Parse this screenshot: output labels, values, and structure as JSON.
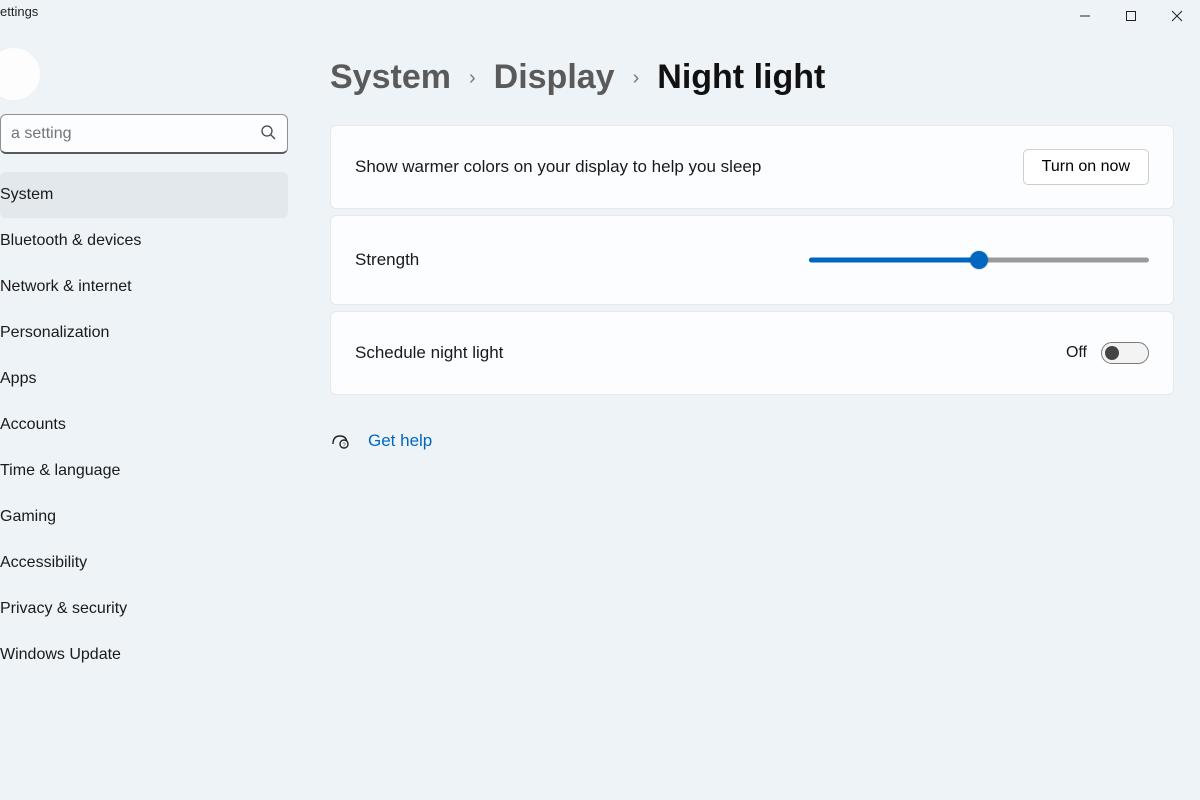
{
  "window": {
    "title": "ettings"
  },
  "search": {
    "placeholder": "a setting"
  },
  "sidebar": {
    "items": [
      {
        "label": "System",
        "active": true
      },
      {
        "label": "Bluetooth & devices"
      },
      {
        "label": "Network & internet"
      },
      {
        "label": "Personalization"
      },
      {
        "label": "Apps"
      },
      {
        "label": "Accounts"
      },
      {
        "label": "Time & language"
      },
      {
        "label": "Gaming"
      },
      {
        "label": "Accessibility"
      },
      {
        "label": "Privacy & security"
      },
      {
        "label": "Windows Update"
      }
    ]
  },
  "breadcrumb": {
    "segments": [
      "System",
      "Display"
    ],
    "current": "Night light"
  },
  "cards": {
    "description": "Show warmer colors on your display to help you sleep",
    "turn_on_label": "Turn on now",
    "strength_label": "Strength",
    "strength_percent": 50,
    "schedule_label": "Schedule night light",
    "schedule_state": "Off"
  },
  "help": {
    "label": "Get help"
  }
}
